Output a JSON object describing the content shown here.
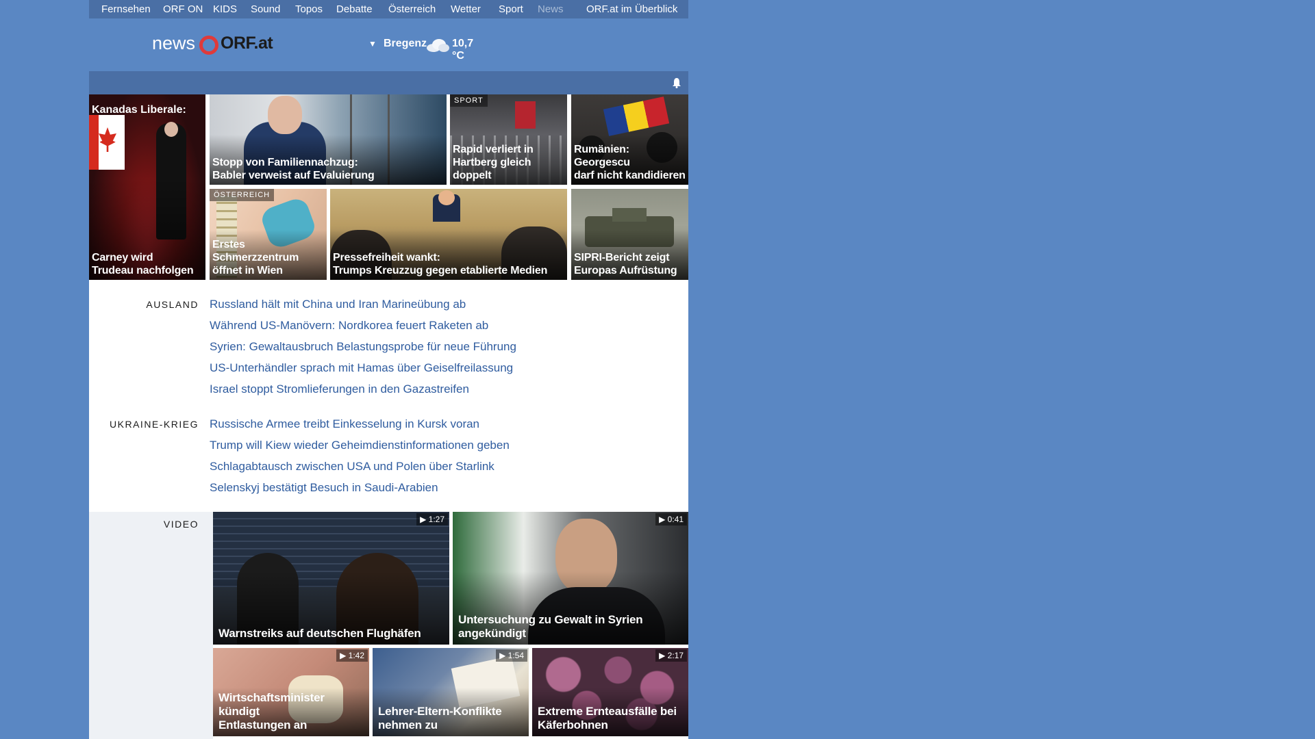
{
  "nav": {
    "items": [
      {
        "label": "Fernsehen",
        "muted": false
      },
      {
        "label": "ORF ON",
        "muted": false
      },
      {
        "label": "KIDS",
        "muted": false
      },
      {
        "label": "Sound",
        "muted": false
      },
      {
        "label": "Topos",
        "muted": false
      },
      {
        "label": "Debatte",
        "muted": false
      },
      {
        "label": "Österreich",
        "muted": false
      },
      {
        "label": "Wetter",
        "muted": false
      },
      {
        "label": "Sport",
        "muted": false
      },
      {
        "label": "News",
        "muted": true
      },
      {
        "label": "ORF.at im Überblick",
        "muted": false
      }
    ]
  },
  "header": {
    "logo_news": "news",
    "logo_orf": "ORF.at",
    "weather_city": "Bregenz",
    "weather_temp": "10,7 °C"
  },
  "teasers": [
    {
      "kicker": "Kanadas Liberale:",
      "caption_line1": "Carney wird",
      "caption_line2": "Trudeau nachfolgen"
    },
    {
      "caption_line1": "Stopp von Familiennachzug:",
      "caption_line2": "Babler verweist auf Evaluierung"
    },
    {
      "tag": "SPORT",
      "caption_line1": "Rapid verliert in",
      "caption_line2": "Hartberg gleich doppelt"
    },
    {
      "caption_line1": "Rumänien: Georgescu",
      "caption_line2": "darf nicht kandidieren"
    },
    {
      "tag": "ÖSTERREICH",
      "caption_line1": "Erstes Schmerzzentrum",
      "caption_line2": "öffnet in Wien"
    },
    {
      "caption_line1": "Pressefreiheit wankt:",
      "caption_line2": "Trumps Kreuzzug gegen etablierte Medien"
    },
    {
      "caption_line1": "SIPRI-Bericht zeigt",
      "caption_line2": "Europas Aufrüstung"
    }
  ],
  "sections": {
    "ausland": {
      "label": "AUSLAND",
      "links": [
        "Russland hält mit China und Iran Marineübung ab",
        "Während US-Manövern: Nordkorea feuert Raketen ab",
        "Syrien: Gewaltausbruch Belastungsprobe für neue Führung",
        "US-Unterhändler sprach mit Hamas über Geiselfreilassung",
        "Israel stoppt Stromlieferungen in den Gazastreifen"
      ]
    },
    "ukraine": {
      "label": "UKRAINE-KRIEG",
      "links": [
        "Russische Armee treibt Einkesselung in Kursk voran",
        "Trump will Kiew wieder Geheimdienstinformationen geben",
        "Schlagabtausch zwischen USA und Polen über Starlink",
        "Selenskyj bestätigt Besuch in Saudi-Arabien"
      ]
    }
  },
  "video": {
    "label": "VIDEO",
    "items": [
      {
        "duration": "▶ 1:27",
        "caption_line1": "Warnstreiks auf deutschen Flughäfen",
        "caption_line2": ""
      },
      {
        "duration": "▶ 0:41",
        "caption_line1": "Untersuchung zu Gewalt in Syrien",
        "caption_line2": "angekündigt"
      },
      {
        "duration": "▶ 1:42",
        "caption_line1": "Wirtschaftsminister kündigt",
        "caption_line2": "Entlastungen an"
      },
      {
        "duration": "▶ 1:54",
        "caption_line1": "Lehrer-Eltern-Konflikte",
        "caption_line2": "nehmen zu"
      },
      {
        "duration": "▶ 2:17",
        "caption_line1": "Extreme Ernteausfälle bei",
        "caption_line2": "Käferbohnen"
      }
    ]
  },
  "colors": {
    "page_bg": "#5a87c3",
    "nav_bg": "#4a6fa5",
    "link": "#2f5c9f",
    "logo_ring": "#e03a3a"
  }
}
